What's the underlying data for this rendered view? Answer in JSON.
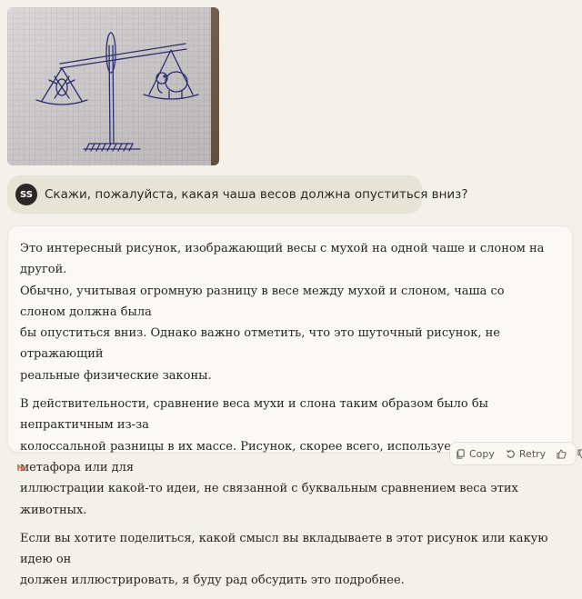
{
  "image": {
    "alt_icon": "scale-drawing-image"
  },
  "user": {
    "initials": "SS",
    "message": "Скажи, пожалуйста, какая чаша весов должна опуститься вниз?"
  },
  "assistant": {
    "paragraphs": [
      [
        "Это интересный рисунок, изображающий весы с мухой на одной чаше и слоном на другой.",
        "Обычно, учитывая огромную разницу в весе между мухой и слоном, чаша со слоном должна была",
        "бы опуститься вниз. Однако важно отметить, что это шуточный рисунок, не отражающий",
        "реальные физические законы."
      ],
      [
        "В действительности, сравнение веса мухи и слона таким образом было бы непрактичным из-за",
        "колоссальной разницы в их массе. Рисунок, скорее всего, используется как метафора или для",
        "иллюстрации какой-то идеи, не связанной с буквальным сравнением веса этих животных."
      ],
      [
        "Если вы хотите поделиться, какой смысл вы вкладываете в этот рисунок или какую идею он",
        "должен иллюстрировать, я буду рад обсудить это подробнее."
      ]
    ]
  },
  "actions": {
    "copy_label": "Copy",
    "retry_label": "Retry"
  },
  "colors": {
    "accent": "#d4693c",
    "avatar_bg": "#2a2826",
    "page_bg": "#f3f1ea"
  }
}
